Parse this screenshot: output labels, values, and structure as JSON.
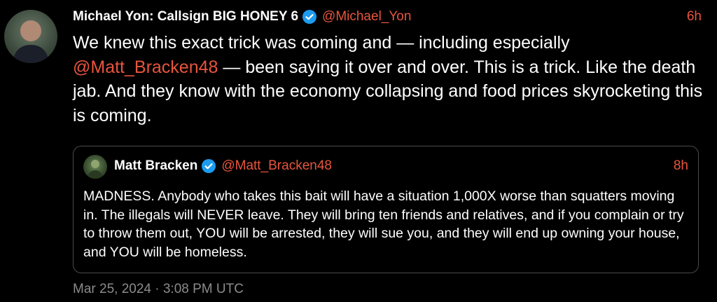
{
  "tweet": {
    "author_name": "Michael Yon: Callsign BIG HONEY 6",
    "handle": "@Michael_Yon",
    "time": "6h",
    "text_part1": "We knew this exact trick was coming and — including especially ",
    "mention": "@Matt_Bracken48",
    "text_part2": " — been saying it over and over.  This is a trick.  Like the death jab.  And they know with the economy collapsing and food prices skyrocketing this is coming.",
    "timestamp": "Mar 25, 2024 · 3:08 PM UTC"
  },
  "quoted_tweet": {
    "author_name": "Matt Bracken",
    "handle": "@Matt_Bracken48",
    "time": "8h",
    "text": "MADNESS. Anybody who takes this bait will have a situation 1,000X worse than squatters moving in. The illegals will NEVER leave. They will bring ten friends and relatives, and if you complain or try to throw them out, YOU will be arrested, they will sue you, and they will end up owning your house, and YOU will be homeless."
  },
  "icons": {
    "verified": "verified-badge-icon",
    "avatar": "avatar"
  },
  "colors": {
    "background": "#000000",
    "text": "#ffffff",
    "accent": "#e8553d",
    "muted": "#8b8b8b",
    "border": "#4a4a4a",
    "verified": "#1d9bf0"
  }
}
